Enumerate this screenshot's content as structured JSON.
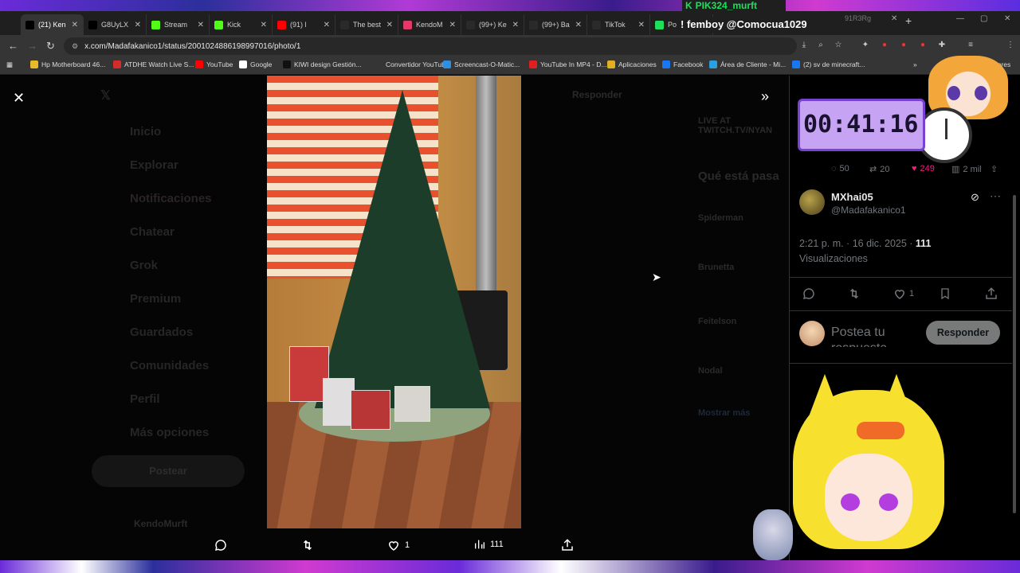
{
  "browser": {
    "tabs": [
      {
        "label": "(21) Ken",
        "icon": "x-logo",
        "color": "#000000"
      },
      {
        "label": "G8UyLX",
        "icon": "x-logo",
        "color": "#000000"
      },
      {
        "label": "Stream",
        "icon": "kick-logo",
        "color": "#53fc18"
      },
      {
        "label": "Kick",
        "icon": "kick-logo",
        "color": "#53fc18"
      },
      {
        "label": "(91) l",
        "icon": "youtube-logo",
        "color": "#ff0000"
      },
      {
        "label": "The best",
        "icon": "diamond-logo",
        "color": "#ffffff"
      },
      {
        "label": "KendoM",
        "icon": "app-logo",
        "color": "#e03a6a"
      },
      {
        "label": "(99+) Ke",
        "icon": "tiktok-logo",
        "color": "#ffffff"
      },
      {
        "label": "(99+) Ba",
        "icon": "tiktok-logo",
        "color": "#ffffff"
      },
      {
        "label": "TikTok",
        "icon": "tiktok-logo",
        "color": "#ffffff"
      },
      {
        "label": "Po",
        "icon": "web-logo",
        "color": "#1ce05c"
      }
    ],
    "extra_tab": "91R3Rg",
    "new_tab": "+",
    "url": "x.com/Madafakanico1/status/2001024886198997016/photo/1",
    "bookmarks": [
      {
        "label": "Hp Motherboard 46...",
        "color": "#e8b928"
      },
      {
        "label": "ATDHE Watch Live S...",
        "color": "#d62b2b"
      },
      {
        "label": "YouTube",
        "color": "#ff0000"
      },
      {
        "label": "Google",
        "color": "#ffffff"
      },
      {
        "label": "KIWI design Gestión...",
        "color": "#111111"
      },
      {
        "label": "Convertidor YouTub...",
        "color": "#353535"
      },
      {
        "label": "Screencast-O-Matic...",
        "color": "#2e8fe0"
      },
      {
        "label": "YouTube In MP4 - D...",
        "color": "#e02020"
      },
      {
        "label": "Aplicaciones",
        "color": "#e0b020"
      },
      {
        "label": "Facebook",
        "color": "#1877f2"
      },
      {
        "label": "Área de Cliente - Mi...",
        "color": "#2aa0e0"
      },
      {
        "label": "(2) sv de minecraft...",
        "color": "#1877f2"
      }
    ],
    "bookmarks_more": "»",
    "bookmarks_overflow": "cadores"
  },
  "background_nav": [
    "Inicio",
    "Explorar",
    "Notificaciones",
    "Chatear",
    "Grok",
    "Premium",
    "Guardados",
    "Comunidades",
    "Perfil",
    "Más opciones"
  ],
  "background_post_button": "Postear",
  "background_user": "KendoMurft",
  "background_reply_label": "Responder",
  "background_live": "LIVE AT TWITCH.TV/NYAN",
  "background_trends_title": "Qué está pasa",
  "background_trends": [
    "Spiderman",
    "Brunetta",
    "Feitelson",
    "Nodal"
  ],
  "background_footer": "Mostrar más",
  "photo": {
    "toolbar": {
      "reply_count": "",
      "repost_count": "",
      "like_count": "1",
      "views_count": "111"
    }
  },
  "panel": {
    "prev_post_stats": {
      "replies": "50",
      "reposts": "20",
      "likes": "249",
      "views": "2 mil"
    },
    "author": {
      "name": "MXhai05",
      "handle": "@Madafakanico1"
    },
    "meta": {
      "time": "2:21 p. m. · 16 dic. 2025 · ",
      "views_number": "111",
      "views_label": "Visualizaciones"
    },
    "actions": {
      "likes": "1"
    },
    "reply": {
      "placeholder": "Postea tu respuesta",
      "button": "Responder"
    }
  },
  "overlay": {
    "viewer_tag": "PIK324_murft",
    "chat_line": "! femboy @Comocua1029",
    "timer": "00:41:16"
  },
  "colors": {
    "like_pink": "#f91880",
    "accent_purple": "#7a42d2",
    "timer_bg": "#c6a4f3"
  }
}
